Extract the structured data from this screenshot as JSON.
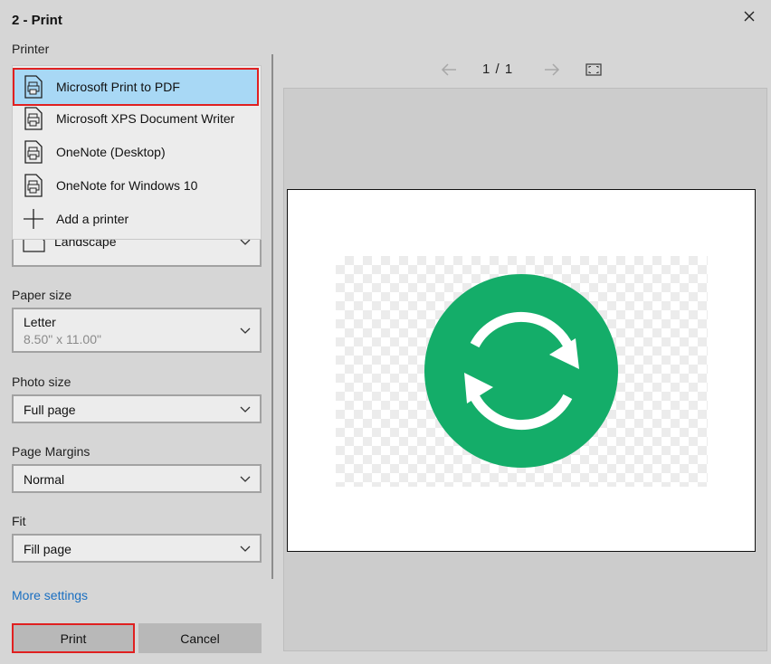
{
  "window": {
    "title": "2 - Print"
  },
  "printer": {
    "label": "Printer",
    "options": [
      {
        "label": "Microsoft Print to PDF",
        "icon": "printer-icon",
        "selected": true
      },
      {
        "label": "Microsoft XPS Document Writer",
        "icon": "printer-icon"
      },
      {
        "label": "OneNote (Desktop)",
        "icon": "printer-icon"
      },
      {
        "label": "OneNote for Windows 10",
        "icon": "printer-icon"
      },
      {
        "label": "Add a printer",
        "icon": "plus-icon"
      }
    ]
  },
  "orientation": {
    "value": "Landscape",
    "icon": "landscape-page-icon"
  },
  "paper_size": {
    "label": "Paper size",
    "value": "Letter",
    "detail": "8.50\" x 11.00\""
  },
  "photo_size": {
    "label": "Photo size",
    "value": "Full page"
  },
  "margins": {
    "label": "Page Margins",
    "value": "Normal"
  },
  "fit": {
    "label": "Fit",
    "value": "Fill page"
  },
  "more_settings": "More settings",
  "buttons": {
    "print": "Print",
    "cancel": "Cancel"
  },
  "pager": {
    "text": "1 / 1"
  },
  "colors": {
    "accent_link": "#1a6fc1",
    "selection": "#a8d8f5",
    "highlight_border": "#e02020",
    "sync_icon_green": "#14ad69"
  }
}
